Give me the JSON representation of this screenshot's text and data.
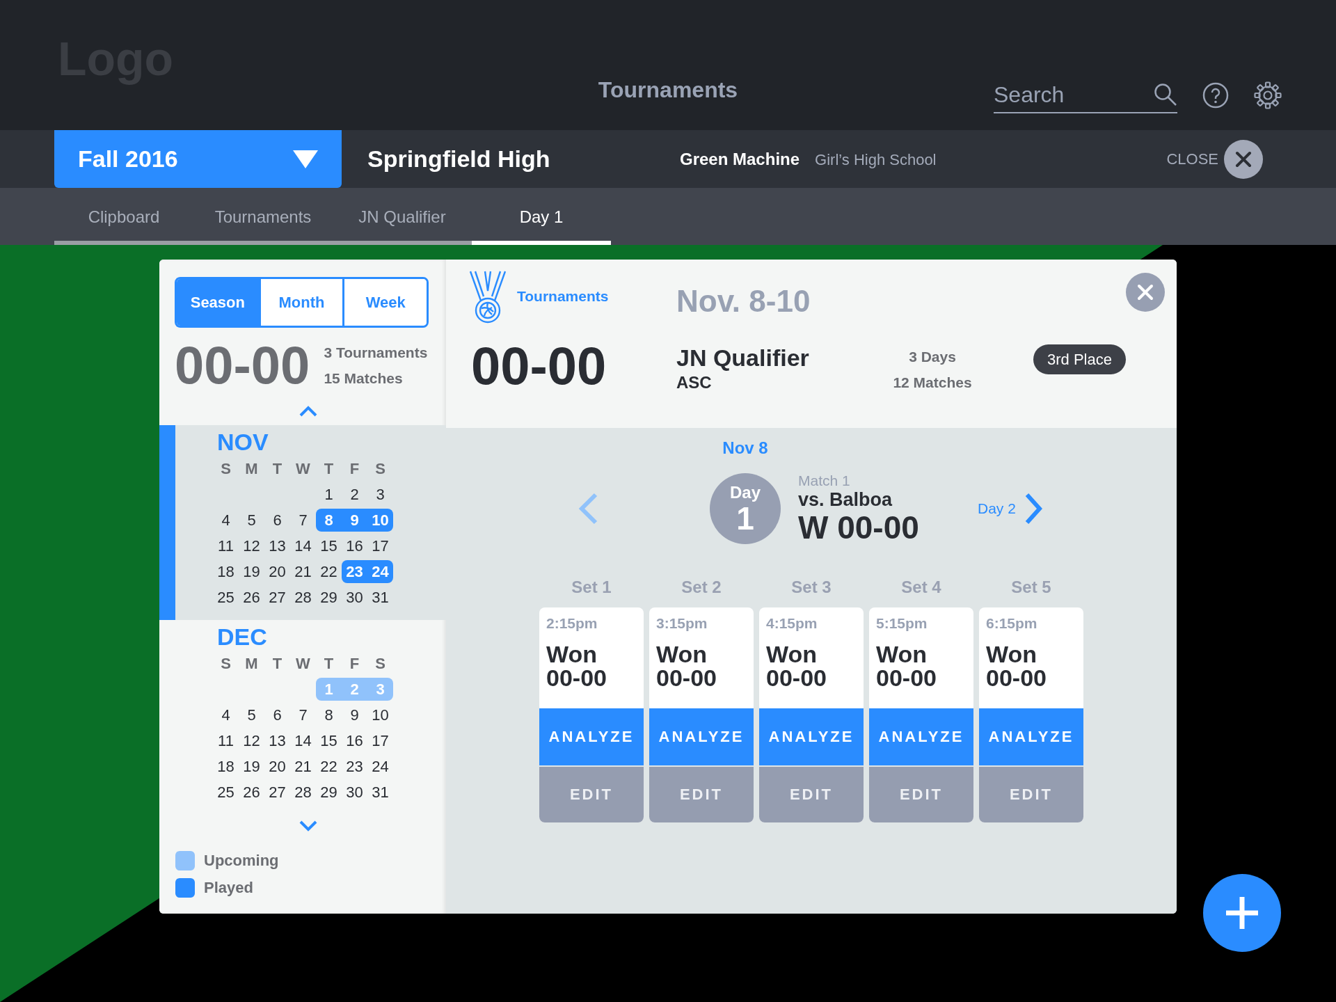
{
  "header": {
    "logo": "Logo",
    "title": "Tournaments",
    "search": {
      "placeholder": "Search"
    }
  },
  "context_bar": {
    "season": "Fall 2016",
    "school": "Springfield High",
    "team": "Green Machine",
    "division": "Girl’s High School",
    "close": "CLOSE"
  },
  "breadcrumbs": [
    {
      "label": "Clipboard",
      "selected": false
    },
    {
      "label": "Tournaments",
      "selected": false
    },
    {
      "label": "JN Qualifier",
      "selected": false
    },
    {
      "label": "Day 1",
      "selected": true
    }
  ],
  "sidebar": {
    "views": [
      {
        "label": "Season",
        "selected": true
      },
      {
        "label": "Month",
        "selected": false
      },
      {
        "label": "Week",
        "selected": false
      }
    ],
    "record": "00-00",
    "stats": [
      "3 Tournaments",
      "15 Matches"
    ],
    "months": [
      {
        "name": "NOV",
        "selected": true,
        "weekdays": [
          "S",
          "M",
          "T",
          "W",
          "T",
          "F",
          "S"
        ],
        "weeks": [
          {
            "align_end": true,
            "segments": [
              {
                "played": false,
                "upcoming": false,
                "days": [
                  "1",
                  "2",
                  "3"
                ]
              }
            ]
          },
          {
            "segments": [
              {
                "played": false,
                "upcoming": false,
                "days": [
                  "4",
                  "5",
                  "6",
                  "7"
                ]
              },
              {
                "played": true,
                "upcoming": false,
                "days": [
                  "8",
                  "9",
                  "10"
                ]
              }
            ]
          },
          {
            "segments": [
              {
                "played": false,
                "upcoming": false,
                "days": [
                  "11",
                  "12",
                  "13",
                  "14",
                  "15",
                  "16",
                  "17"
                ]
              }
            ]
          },
          {
            "segments": [
              {
                "played": false,
                "upcoming": false,
                "days": [
                  "18",
                  "19",
                  "20",
                  "21",
                  "22"
                ]
              },
              {
                "played": true,
                "upcoming": false,
                "days": [
                  "23",
                  "24"
                ]
              }
            ]
          },
          {
            "segments": [
              {
                "played": false,
                "upcoming": false,
                "days": [
                  "25",
                  "26",
                  "27",
                  "28",
                  "29",
                  "30",
                  "31"
                ]
              }
            ]
          }
        ]
      },
      {
        "name": "DEC",
        "selected": false,
        "weekdays": [
          "S",
          "M",
          "T",
          "W",
          "T",
          "F",
          "S"
        ],
        "weeks": [
          {
            "align_end": true,
            "segments": [
              {
                "played": false,
                "upcoming": true,
                "days": [
                  "1",
                  "2",
                  "3"
                ]
              }
            ]
          },
          {
            "segments": [
              {
                "played": false,
                "upcoming": false,
                "days": [
                  "4",
                  "5",
                  "6",
                  "7",
                  "8",
                  "9",
                  "10"
                ]
              }
            ]
          },
          {
            "segments": [
              {
                "played": false,
                "upcoming": false,
                "days": [
                  "11",
                  "12",
                  "13",
                  "14",
                  "15",
                  "16",
                  "17"
                ]
              }
            ]
          },
          {
            "segments": [
              {
                "played": false,
                "upcoming": false,
                "days": [
                  "18",
                  "19",
                  "20",
                  "21",
                  "22",
                  "23",
                  "24"
                ]
              }
            ]
          },
          {
            "segments": [
              {
                "played": false,
                "upcoming": false,
                "days": [
                  "25",
                  "26",
                  "27",
                  "28",
                  "29",
                  "30",
                  "31"
                ]
              }
            ]
          }
        ]
      }
    ],
    "legend": [
      {
        "label": "Upcoming",
        "color": "#90c2fb"
      },
      {
        "label": "Played",
        "color": "#2a8cff"
      }
    ]
  },
  "tournament": {
    "section": "Tournaments",
    "dates": "Nov. 8-10",
    "record": "00-00",
    "name": "JN Qualifier",
    "venue": "ASC",
    "stats": [
      "3 Days",
      "12 Matches"
    ],
    "placement": "3rd Place"
  },
  "day": {
    "date": "Nov 8",
    "day_label": "Day",
    "day_number": "1",
    "match_label": "Match 1",
    "opponent": "vs. Balboa",
    "result": "W 00-00",
    "next": "Day 2",
    "sets": [
      {
        "label": "Set 1",
        "time": "2:15pm",
        "outcome": "Won",
        "score": "00-00",
        "analyze": "ANALYZE",
        "edit": "EDIT"
      },
      {
        "label": "Set 2",
        "time": "3:15pm",
        "outcome": "Won",
        "score": "00-00",
        "analyze": "ANALYZE",
        "edit": "EDIT"
      },
      {
        "label": "Set 3",
        "time": "4:15pm",
        "outcome": "Won",
        "score": "00-00",
        "analyze": "ANALYZE",
        "edit": "EDIT"
      },
      {
        "label": "Set 4",
        "time": "5:15pm",
        "outcome": "Won",
        "score": "00-00",
        "analyze": "ANALYZE",
        "edit": "EDIT"
      },
      {
        "label": "Set 5",
        "time": "6:15pm",
        "outcome": "Won",
        "score": "00-00",
        "analyze": "ANALYZE",
        "edit": "EDIT"
      }
    ]
  }
}
